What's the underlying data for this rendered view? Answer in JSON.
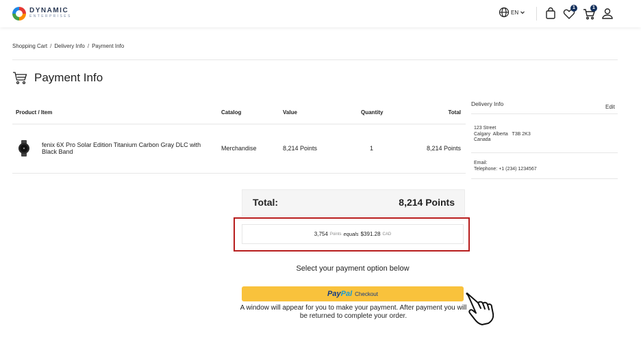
{
  "header": {
    "logo_title": "DYNAMIC",
    "logo_sub": "ENTERPRISES",
    "language": "EN",
    "wishlist_count": "1",
    "cart_count": "1",
    "icons": [
      "globe-icon",
      "chevron-down-icon",
      "bag-icon",
      "heart-icon",
      "cart-icon",
      "user-icon"
    ]
  },
  "breadcrumb": {
    "items": [
      "Shopping Cart",
      "Delivery Info",
      "Payment Info"
    ],
    "separator": "/"
  },
  "page": {
    "title": "Payment Info"
  },
  "table": {
    "headers": [
      "Product / Item",
      "Catalog",
      "Value",
      "Quantity",
      "Total"
    ],
    "rows": [
      {
        "name": "fenix 6X Pro Solar Edition Titanium Carbon Gray DLC with Black Band",
        "catalog": "Merchandise",
        "value": "8,214 Points",
        "quantity": "1",
        "total": "8,214 Points"
      }
    ]
  },
  "delivery": {
    "title": "Delivery Info",
    "edit_label": "Edit",
    "address_lines": [
      "123 Street",
      "Calgary  Alberta   T3B 2K3",
      "Canada"
    ],
    "email_line": "Email: ",
    "telephone_line": "Telephone: +1 (234) 1234567"
  },
  "summary": {
    "total_label": "Total:",
    "total_value": "8,214 Points",
    "conversion_points": "3,754",
    "conversion_points_label": "Points",
    "conversion_equals": "equals",
    "conversion_amount": "$391.28",
    "conversion_currency": "CAD"
  },
  "payment": {
    "select_text": "Select your payment option below",
    "paypal_pay": "Pay",
    "paypal_pal": "Pal",
    "paypal_checkout": "Checkout",
    "notice": "A window will appear for you to make your payment. After payment you will be returned to complete your order."
  },
  "colors": {
    "accent_navy": "#13305c",
    "highlight_red": "#b71c1c",
    "paypal_yellow": "#f9c23c",
    "paypal_dark_blue": "#123984",
    "paypal_light_blue": "#179bd7"
  }
}
